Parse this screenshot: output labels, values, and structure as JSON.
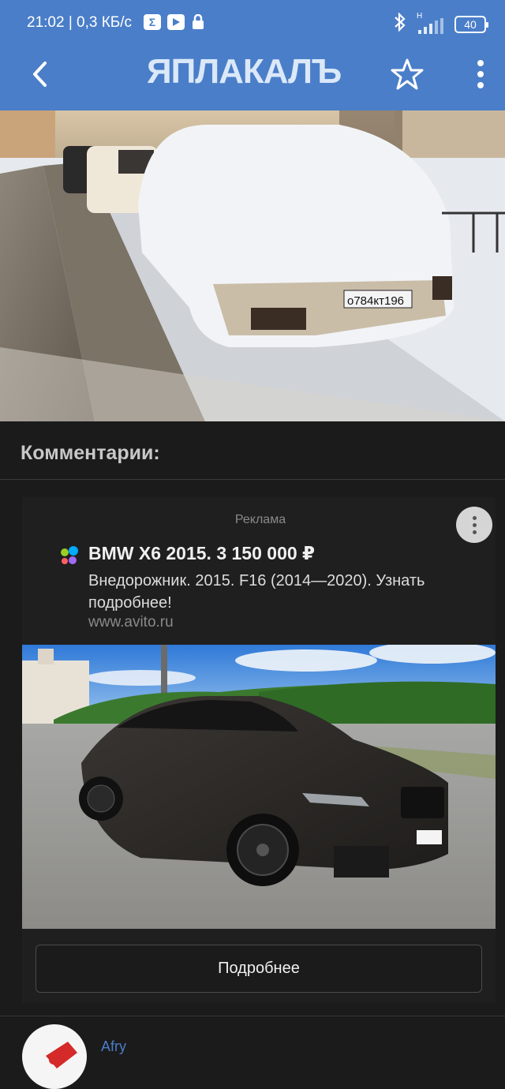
{
  "status": {
    "time": "21:02",
    "speed": "0,3 КБ/с",
    "battery": "40",
    "network": "H",
    "icons": [
      "sigma-icon",
      "youtube-icon",
      "lock-icon",
      "bluetooth-icon",
      "signal-icon",
      "battery-icon"
    ]
  },
  "appbar": {
    "logo_text": "ЯПЛАКАЛЪ",
    "icons": [
      "back-arrow-icon",
      "star-icon",
      "more-vertical-icon"
    ]
  },
  "comments": {
    "title": "Комментарии:"
  },
  "ad": {
    "label": "Реклама",
    "title": "BMW X6 2015. 3 150 000 ₽",
    "description": "Внедорожник. 2015. F16 (2014—2020). Узнать подробнее!",
    "url": "www.avito.ru",
    "button": "Подробнее"
  },
  "comment_preview": {
    "author": "Afry"
  },
  "colors": {
    "accent": "#4a7ec9",
    "background": "#1b1b1b"
  }
}
